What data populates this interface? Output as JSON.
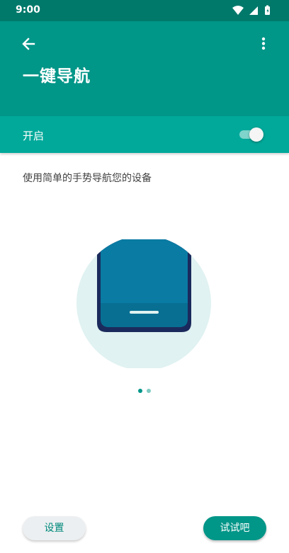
{
  "status_bar": {
    "time": "9:00",
    "icons": [
      "wifi-icon",
      "cellular-signal-icon",
      "battery-icon"
    ]
  },
  "app_bar": {
    "back_icon": "arrow-back-icon",
    "more_icon": "more-vertical-icon",
    "title": "一键导航"
  },
  "toggle": {
    "label": "开启",
    "checked": true
  },
  "description": "使用简单的手势导航您的设备",
  "illustration": {
    "icon": "phone-gesture-illustration"
  },
  "pager": {
    "count": 2,
    "current": 1
  },
  "actions": {
    "settings_label": "设置",
    "try_label": "试试吧"
  },
  "colors": {
    "status_bar": "#00796b",
    "app_bar": "#009688",
    "toggle_bar": "#00a99a",
    "accent": "#009688",
    "illustration_circle": "#e0f2f1",
    "phone_screen": "#0a7ba3",
    "phone_body": "#1b2a5c"
  }
}
